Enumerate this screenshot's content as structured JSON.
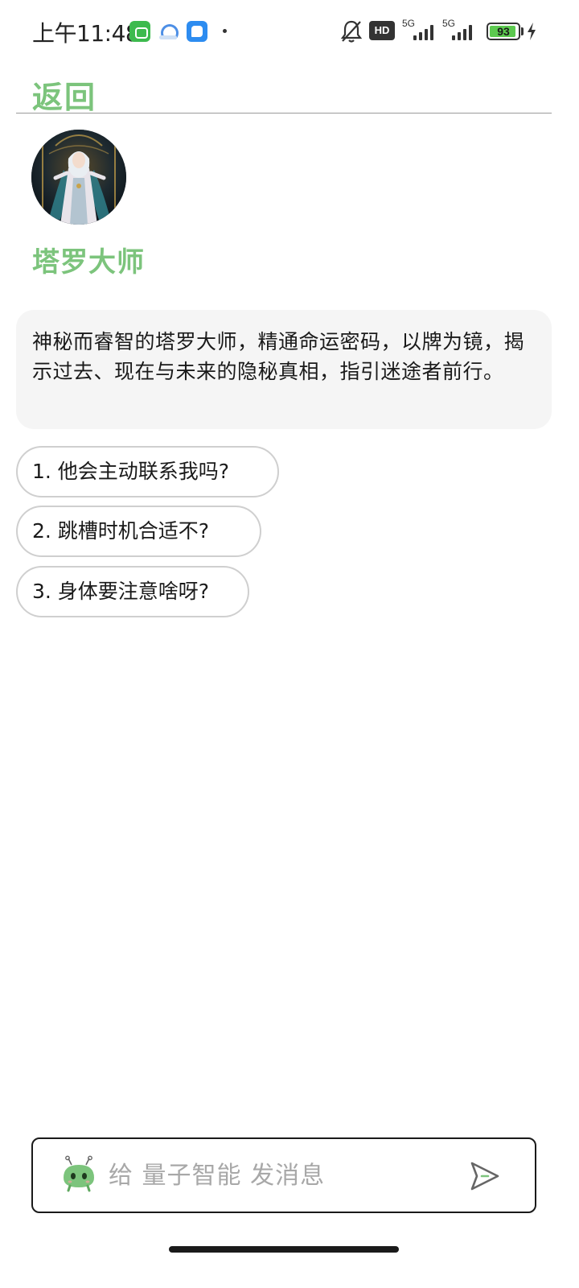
{
  "status_bar": {
    "time": "上午11:48",
    "hd_label": "HD",
    "network_1": "5G",
    "network_2": "5G",
    "battery_level": "93",
    "battery_fraction": 0.93,
    "icons": [
      "app-notification-icon",
      "cloud-sync-icon",
      "chat-app-icon",
      "bell-muted-icon",
      "hd-voice-icon",
      "signal-icon",
      "battery-icon",
      "charging-icon"
    ]
  },
  "header": {
    "back_label": "返回"
  },
  "assistant": {
    "name": "塔罗大师",
    "description": "神秘而睿智的塔罗大师，精通命运密码，以牌为镜，揭示过去、现在与未来的隐秘真相，指引迷途者前行。"
  },
  "suggestions": [
    {
      "label": "1. 他会主动联系我吗?"
    },
    {
      "label": "2. 跳槽时机合适不?"
    },
    {
      "label": "3. 身体要注意啥呀?"
    }
  ],
  "composer": {
    "placeholder": "给 量子智能 发消息",
    "value": ""
  },
  "colors": {
    "accent_green": "#7cc47c",
    "card_bg": "#f5f5f5",
    "border": "#cfcfcf"
  }
}
